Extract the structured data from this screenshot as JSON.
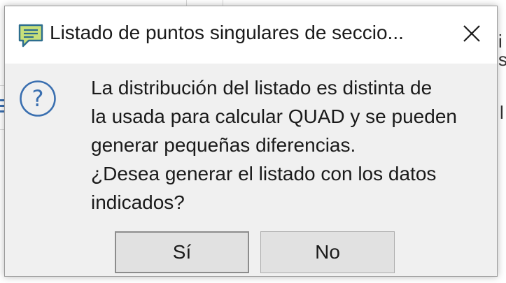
{
  "dialog": {
    "title": "Listado de puntos singulares de seccio...",
    "title_icon": "message-icon",
    "close_icon": "close-icon",
    "question_icon": "question-icon",
    "message_lines": [
      "La distribución del listado es distinta de",
      "la usada para calcular QUAD y se pueden",
      "generar pequeñas diferencias.",
      "¿Desea generar el listado con los datos",
      "indicados?"
    ],
    "buttons": {
      "yes_label": "Sí",
      "no_label": "No"
    }
  },
  "background": {
    "fragments": [
      "i",
      "s",
      "l"
    ]
  },
  "colors": {
    "dialog_bg": "#f0f0f0",
    "titlebar_bg": "#ffffff",
    "accent_blue": "#3a6fb0",
    "title_icon_green": "#c8e07a",
    "button_bg": "#e1e1e1"
  }
}
